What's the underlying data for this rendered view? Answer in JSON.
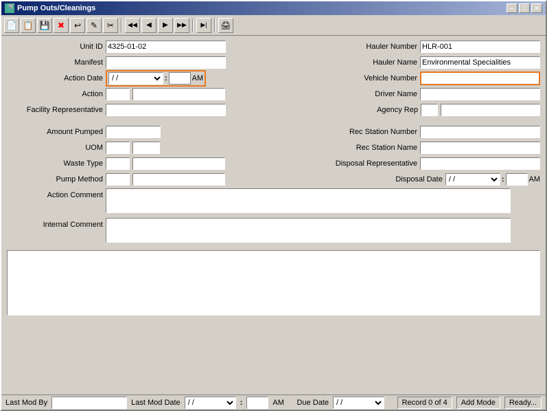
{
  "window": {
    "title": "Pump Outs/Cleanings",
    "close_btn": "✕",
    "min_btn": "─",
    "max_btn": "□"
  },
  "toolbar": {
    "buttons": [
      {
        "name": "new",
        "icon": "📄"
      },
      {
        "name": "copy",
        "icon": "📋"
      },
      {
        "name": "save",
        "icon": "💾"
      },
      {
        "name": "delete",
        "icon": "✖"
      },
      {
        "name": "undo",
        "icon": "↩"
      },
      {
        "name": "edit",
        "icon": "✎"
      },
      {
        "name": "cut",
        "icon": "✂"
      },
      {
        "separator": true
      },
      {
        "name": "nav-first",
        "icon": "◀◀"
      },
      {
        "name": "nav-prev",
        "icon": "◀"
      },
      {
        "name": "nav-next",
        "icon": "▶"
      },
      {
        "name": "nav-last",
        "icon": "▶▶"
      },
      {
        "separator": true
      },
      {
        "name": "nav-jump",
        "icon": "▶|"
      },
      {
        "separator": true
      },
      {
        "name": "print",
        "icon": "🖨"
      }
    ]
  },
  "form": {
    "unit_id_label": "Unit ID",
    "unit_id_value": "4325-01-02",
    "manifest_label": "Manifest",
    "manifest_value": "",
    "action_date_label": "Action Date",
    "action_date_value": " /  /",
    "action_time_value": "",
    "action_ampm": "AM",
    "action_label": "Action",
    "action_value": "",
    "facility_rep_label": "Facility Representative",
    "facility_rep_value": "",
    "amount_pumped_label": "Amount Pumped",
    "amount_pumped_value": "",
    "uom_label": "UOM",
    "uom_value": "",
    "waste_type_label": "Waste Type",
    "waste_type_value": "",
    "pump_method_label": "Pump Method",
    "pump_method_value": "",
    "action_comment_label": "Action Comment",
    "action_comment_value": "",
    "internal_comment_label": "Internal Comment",
    "internal_comment_value": "",
    "hauler_number_label": "Hauler Number",
    "hauler_number_value": "HLR-001",
    "hauler_name_label": "Hauler Name",
    "hauler_name_value": "Environmental Specialities",
    "vehicle_number_label": "Vehicle Number",
    "vehicle_number_value": "",
    "driver_name_label": "Driver Name",
    "driver_name_value": "",
    "agency_rep_label": "Agency Rep",
    "agency_rep_value": "",
    "agency_rep_code": "",
    "rec_station_number_label": "Rec Station Number",
    "rec_station_number_value": "",
    "rec_station_name_label": "Rec Station Name",
    "rec_station_name_value": "",
    "disposal_rep_label": "Disposal Representative",
    "disposal_rep_value": "",
    "disposal_date_label": "Disposal Date",
    "disposal_date_value": " /  /",
    "disposal_time_value": "",
    "disposal_ampm": "AM"
  },
  "statusbar": {
    "last_mod_by_label": "Last Mod By",
    "last_mod_by_value": "",
    "last_mod_date_label": "Last Mod Date",
    "last_mod_date_value": " /  /",
    "last_mod_time_value": "",
    "last_mod_ampm": "AM",
    "due_date_label": "Due Date",
    "due_date_value": " /  /",
    "record_info": "Record 0 of 4",
    "mode": "Add Mode",
    "status": "Ready..."
  }
}
